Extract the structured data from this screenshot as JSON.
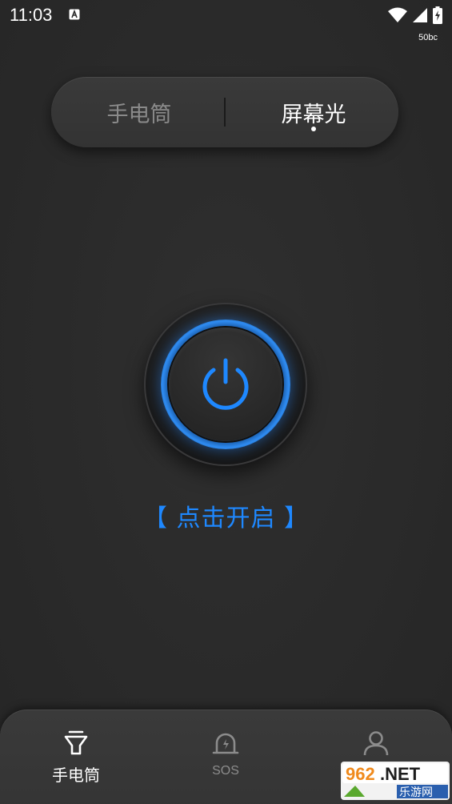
{
  "status_bar": {
    "time": "11:03",
    "sub_label": "50bc"
  },
  "segment": {
    "tabs": [
      {
        "label": "手电筒",
        "active": false
      },
      {
        "label": "屏幕光",
        "active": true
      }
    ]
  },
  "power": {
    "label": "【 点击开启 】",
    "accent_color": "#1e88ff"
  },
  "bottom_nav": {
    "items": [
      {
        "label": "手电筒",
        "icon": "flashlight-icon",
        "active": true
      },
      {
        "label": "SOS",
        "icon": "alarm-icon",
        "active": false
      },
      {
        "label": "",
        "icon": "person-icon",
        "active": false
      }
    ]
  },
  "watermark": {
    "line1": "962.NET",
    "line2": "乐游网"
  }
}
